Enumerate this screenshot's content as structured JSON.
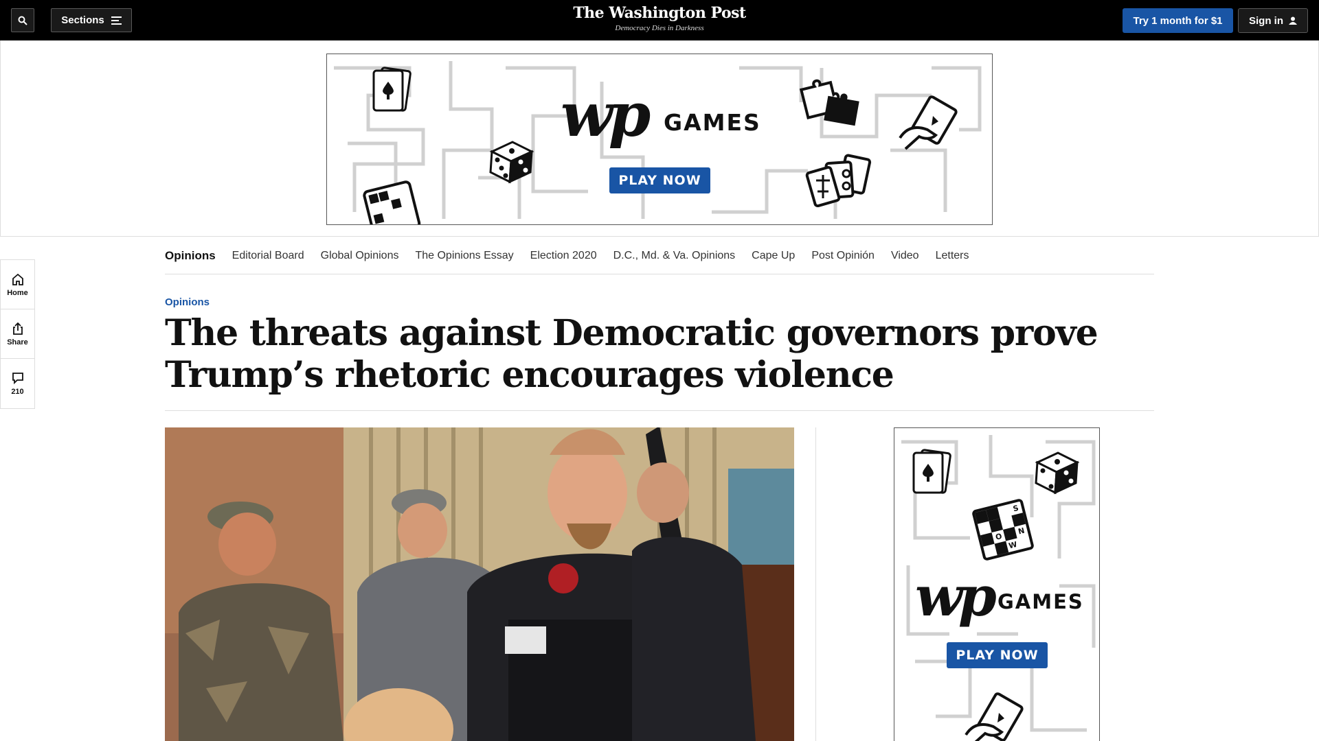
{
  "header": {
    "sections_label": "Sections",
    "logo": "The Washington Post",
    "tagline": "Democracy Dies in Darkness",
    "try_label": "Try 1 month for $1",
    "signin_label": "Sign in"
  },
  "ad": {
    "brand": "wp",
    "games_label": "GAMES",
    "play_label": "PLAY NOW",
    "tile_letters": [
      "S",
      "O",
      "N",
      "W"
    ]
  },
  "rail": {
    "home_label": "Home",
    "share_label": "Share",
    "comments_count": "210"
  },
  "nav": {
    "items": [
      "Opinions",
      "Editorial Board",
      "Global Opinions",
      "The Opinions Essay",
      "Election 2020",
      "D.C., Md. & Va. Opinions",
      "Cape Up",
      "Post Opinión",
      "Video",
      "Letters"
    ]
  },
  "article": {
    "kicker": "Opinions",
    "headline": "The threats against Democratic governors prove Trump’s rhetoric encourages violence"
  },
  "colors": {
    "accent": "#1955a5",
    "topbar": "#000000"
  }
}
